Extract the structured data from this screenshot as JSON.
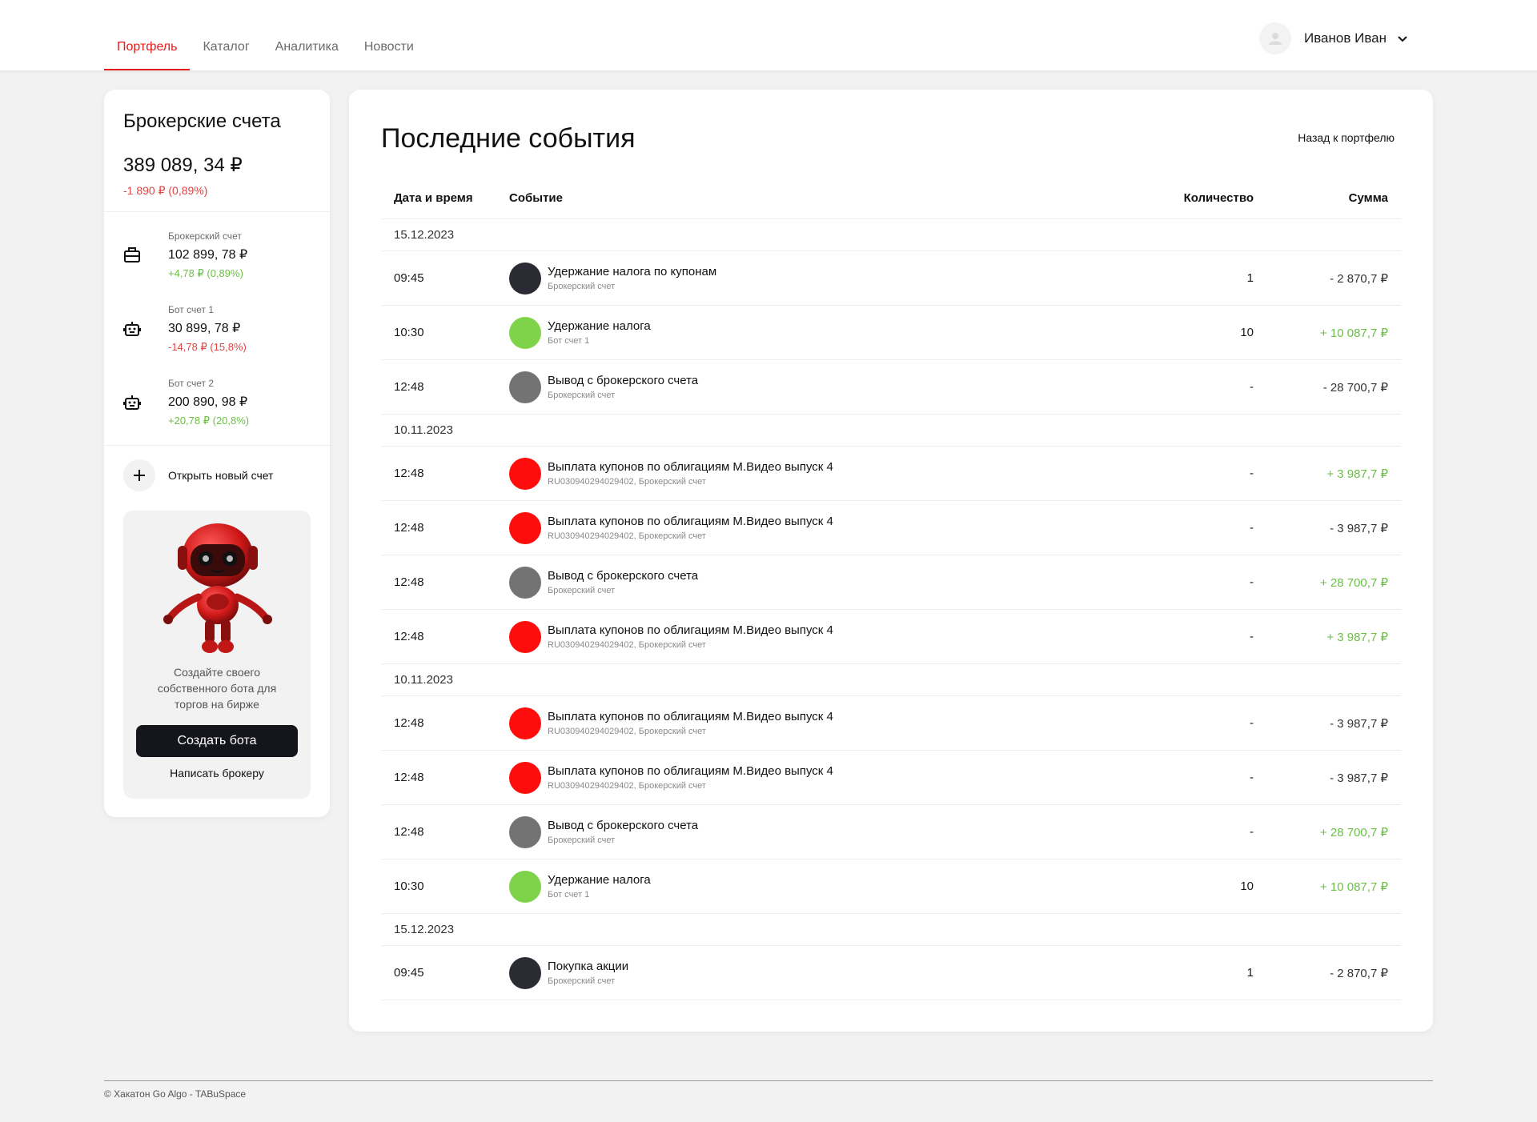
{
  "nav": {
    "items": [
      {
        "label": "Портфель",
        "active": true
      },
      {
        "label": "Каталог",
        "active": false
      },
      {
        "label": "Аналитика",
        "active": false
      },
      {
        "label": "Новости",
        "active": false
      }
    ]
  },
  "user": {
    "name": "Иванов Иван"
  },
  "sidebar": {
    "title": "Брокерские счета",
    "total": "389 089, 34 ₽",
    "total_change": "-1 890 ₽ (0,89%)",
    "accounts": [
      {
        "label": "Брокерский счет",
        "value": "102 899, 78 ₽",
        "change": "+4,78 ₽ (0,89%)",
        "trend": "pos",
        "icon": "briefcase-icon"
      },
      {
        "label": "Бот счет 1",
        "value": "30 899, 78 ₽",
        "change": "-14,78 ₽ (15,8%)",
        "trend": "neg",
        "icon": "robot-icon"
      },
      {
        "label": "Бот счет 2",
        "value": "200 890, 98 ₽",
        "change": "+20,78 ₽ (20,8%)",
        "trend": "pos",
        "icon": "robot-icon"
      }
    ],
    "open_account": "Открыть новый счет",
    "promo": {
      "text": "Создайте своего собственного бота для торгов на бирже",
      "create_button": "Создать бота",
      "write_link": "Написать брокеру"
    }
  },
  "main": {
    "title": "Последние события",
    "back_link": "Назад к портфелю",
    "columns": {
      "time": "Дата и время",
      "event": "Событие",
      "qty": "Количество",
      "sum": "Сумма"
    },
    "groups": [
      {
        "date": "15.12.2023",
        "rows": [
          {
            "time": "09:45",
            "name": "Удержание налога по купонам",
            "sub": "Брокерский счет",
            "qty": "1",
            "sum": "- 2 870,7 ₽",
            "sign": "neg",
            "color": "#2b2c33"
          },
          {
            "time": "10:30",
            "name": "Удержание налога",
            "sub": "Бот счет 1",
            "qty": "10",
            "sum": "+ 10 087,7 ₽",
            "sign": "pos",
            "color": "#7ed34a"
          },
          {
            "time": "12:48",
            "name": "Вывод с брокерского счета",
            "sub": "Брокерский счет",
            "qty": "-",
            "sum": "- 28 700,7 ₽",
            "sign": "neg",
            "color": "#737373"
          }
        ]
      },
      {
        "date": "10.11.2023",
        "rows": [
          {
            "time": "12:48",
            "name": "Выплата купонов по облигациям М.Видео выпуск 4",
            "sub": "RU030940294029402, Брокерский счет",
            "qty": "-",
            "sum": "+ 3 987,7 ₽",
            "sign": "pos",
            "color": "#ff0d0d"
          },
          {
            "time": "12:48",
            "name": "Выплата купонов по облигациям М.Видео выпуск 4",
            "sub": "RU030940294029402, Брокерский счет",
            "qty": "-",
            "sum": "- 3 987,7 ₽",
            "sign": "neg",
            "color": "#ff0d0d"
          },
          {
            "time": "12:48",
            "name": "Вывод с брокерского счета",
            "sub": "Брокерский счет",
            "qty": "-",
            "sum": "+ 28 700,7 ₽",
            "sign": "pos",
            "color": "#737373"
          },
          {
            "time": "12:48",
            "name": "Выплата купонов по облигациям М.Видео выпуск 4",
            "sub": "RU030940294029402, Брокерский счет",
            "qty": "-",
            "sum": "+ 3 987,7 ₽",
            "sign": "pos",
            "color": "#ff0d0d"
          }
        ]
      },
      {
        "date": "10.11.2023",
        "rows": [
          {
            "time": "12:48",
            "name": "Выплата купонов по облигациям М.Видео выпуск 4",
            "sub": "RU030940294029402, Брокерский счет",
            "qty": "-",
            "sum": "- 3 987,7 ₽",
            "sign": "neg",
            "color": "#ff0d0d"
          },
          {
            "time": "12:48",
            "name": "Выплата купонов по облигациям М.Видео выпуск 4",
            "sub": "RU030940294029402, Брокерский счет",
            "qty": "-",
            "sum": "- 3 987,7 ₽",
            "sign": "neg",
            "color": "#ff0d0d"
          },
          {
            "time": "12:48",
            "name": "Вывод с брокерского счета",
            "sub": "Брокерский счет",
            "qty": "-",
            "sum": "+ 28 700,7 ₽",
            "sign": "pos",
            "color": "#737373"
          },
          {
            "time": "10:30",
            "name": "Удержание налога",
            "sub": "Бот счет 1",
            "qty": "10",
            "sum": "+ 10 087,7 ₽",
            "sign": "pos",
            "color": "#7ed34a"
          }
        ]
      },
      {
        "date": "15.12.2023",
        "rows": [
          {
            "time": "09:45",
            "name": "Покупка акции",
            "sub": "Брокерский счет",
            "qty": "1",
            "sum": "- 2 870,7 ₽",
            "sign": "neg",
            "color": "#2b2c33"
          }
        ]
      }
    ]
  },
  "footer": {
    "text": "© Хакатон Go Algo - TABuSpace"
  },
  "colors": {
    "accent": "#e31b1b",
    "positive": "#6bbf45",
    "negative": "#e04545"
  }
}
